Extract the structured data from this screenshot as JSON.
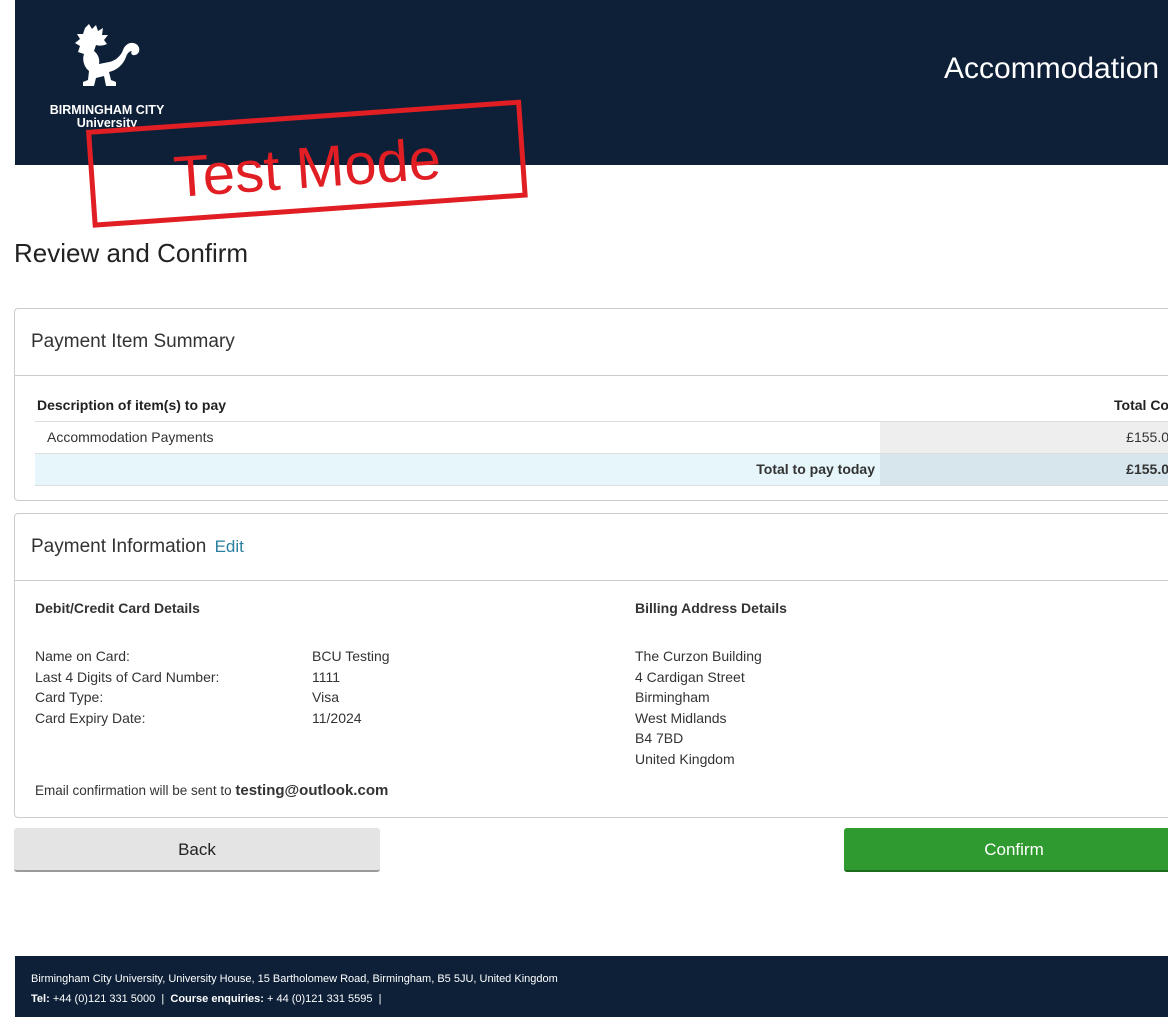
{
  "header": {
    "university_name_line1": "BIRMINGHAM CITY",
    "university_name_line2": "University",
    "title": "Accommodation",
    "logo_icon": "lion-icon"
  },
  "stamp": {
    "text": "Test Mode",
    "color": "#e01e24"
  },
  "page_title": "Review and Confirm",
  "summary": {
    "heading": "Payment Item Summary",
    "col_description": "Description of item(s) to pay",
    "col_total": "Total Co",
    "items": [
      {
        "description": "Accommodation Payments",
        "cost": "£155.0"
      }
    ],
    "total_label": "Total to pay today",
    "total_value": "£155.0"
  },
  "payment_info": {
    "heading": "Payment Information",
    "edit_label": "Edit",
    "card_heading": "Debit/Credit Card Details",
    "card_rows": [
      {
        "label": "Name on Card:",
        "value": "BCU Testing"
      },
      {
        "label": "Last 4 Digits of Card Number:",
        "value": "1111"
      },
      {
        "label": "Card Type:",
        "value": "Visa"
      },
      {
        "label": "Card Expiry Date:",
        "value": "11/2024"
      }
    ],
    "billing_heading": "Billing Address Details",
    "billing_lines": [
      "The Curzon Building",
      "4 Cardigan Street",
      "Birmingham",
      "West Midlands",
      "B4 7BD",
      "United Kingdom"
    ],
    "email_prefix": "Email confirmation will be sent to",
    "email": "testing@outlook.com"
  },
  "buttons": {
    "back": "Back",
    "confirm": "Confirm"
  },
  "footer": {
    "address": "Birmingham City University, University House, 15 Bartholomew Road, Birmingham, B5 5JU, United Kingdom",
    "tel_label": "Tel:",
    "tel": "+44 (0)121 331 5000",
    "sep": "|",
    "course_label": "Course enquiries:",
    "course_tel": "+ 44 (0)121 331 5595",
    "trailing_sep": "|"
  },
  "colors": {
    "header_bg": "#0d2038",
    "confirm_green": "#2f9a2f",
    "link_teal": "#2a7f9e",
    "total_row_bg": "#e6f6fa"
  }
}
